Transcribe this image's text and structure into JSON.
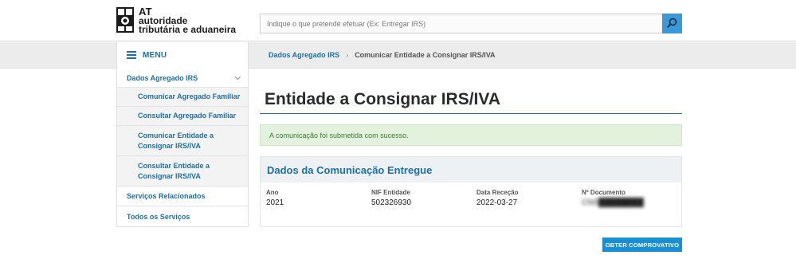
{
  "header": {
    "logo": {
      "line1": "AT",
      "line2": "autoridade",
      "line3": "tributária e aduaneira"
    },
    "search": {
      "placeholder": "Indique o que pretende efetuar (Ex: Entregar IRS)",
      "icon": "search-icon"
    }
  },
  "menu": {
    "label": "MENU",
    "icon": "hamburger-icon"
  },
  "breadcrumb": {
    "items": [
      "Dados Agregado IRS",
      "Comunicar Entidade a Consignar IRS/IVA"
    ],
    "separator": "›"
  },
  "sidebar": {
    "section": {
      "label": "Dados Agregado IRS",
      "icon": "chevron-down-icon",
      "items": [
        {
          "label": "Comunicar Agregado Familiar"
        },
        {
          "label": "Consultar Agregado Familiar"
        },
        {
          "line1": "Comunicar Entidade a",
          "line2": "Consignar IRS/IVA"
        },
        {
          "line1": "Consultar Entidade a",
          "line2": "Consignar IRS/IVA"
        }
      ]
    },
    "links": [
      "Serviços Relacionados",
      "Todos os Serviços"
    ]
  },
  "main": {
    "title": "Entidade a Consignar IRS/IVA",
    "alert": "A comunicação foi submetida com sucesso.",
    "panel": {
      "title": "Dados da Comunicação Entregue",
      "fields": [
        {
          "label": "Ano",
          "value": "2021"
        },
        {
          "label": "NIF Entidade",
          "value": "502326930"
        },
        {
          "label": "Data Receção",
          "value": "2022-03-27"
        },
        {
          "label": "Nº Documento",
          "value": "CNS████████"
        }
      ]
    },
    "button": "OBTER COMPROVATIVO"
  },
  "colors": {
    "accent": "#1d6fa5",
    "button": "#1b8fd6",
    "search_button": "#3a9ad9",
    "success_bg": "#e3f2dd",
    "success_text": "#3d7a35"
  }
}
